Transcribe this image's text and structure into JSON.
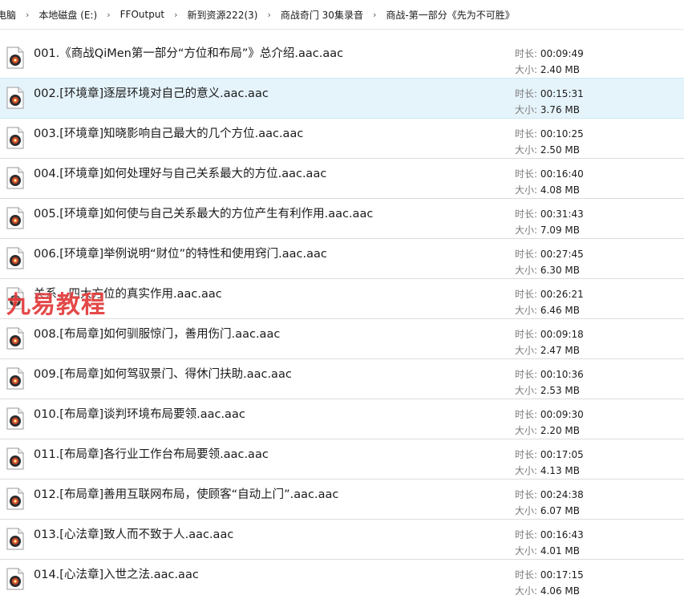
{
  "breadcrumb": [
    "电脑",
    "本地磁盘 (E:)",
    "FFOutput",
    "新到资源222(3)",
    "商战奇门 30集录音",
    "商战-第一部分《先为不可胜》"
  ],
  "labels": {
    "duration": "时长: ",
    "size": "大小: "
  },
  "watermark": "九易教程",
  "files": [
    {
      "name": "001.《商战QiMen第一部分“方位和布局”》总介绍.aac.aac",
      "duration": "00:09:49",
      "size": "2.40 MB"
    },
    {
      "name": "002.[环境章]逐层环境对自己的意义.aac.aac",
      "duration": "00:15:31",
      "size": "3.76 MB"
    },
    {
      "name": "003.[环境章]知晓影响自己最大的几个方位.aac.aac",
      "duration": "00:10:25",
      "size": "2.50 MB"
    },
    {
      "name": "004.[环境章]如何处理好与自己关系最大的方位.aac.aac",
      "duration": "00:16:40",
      "size": "4.08 MB"
    },
    {
      "name": "005.[环境章]如何使与自己关系最大的方位产生有利作用.aac.aac",
      "duration": "00:31:43",
      "size": "7.09 MB"
    },
    {
      "name": "006.[环境章]举例说明“财位”的特性和使用窍门.aac.aac",
      "duration": "00:27:45",
      "size": "6.30 MB"
    },
    {
      "name": "关系、四大方位的真实作用.aac.aac",
      "duration": "00:26:21",
      "size": "6.46 MB"
    },
    {
      "name": "008.[布局章]如何驯服惊门，善用伤门.aac.aac",
      "duration": "00:09:18",
      "size": "2.47 MB"
    },
    {
      "name": "009.[布局章]如何驾驭景门、得休门扶助.aac.aac",
      "duration": "00:10:36",
      "size": "2.53 MB"
    },
    {
      "name": "010.[布局章]谈判环境布局要领.aac.aac",
      "duration": "00:09:30",
      "size": "2.20 MB"
    },
    {
      "name": "011.[布局章]各行业工作台布局要领.aac.aac",
      "duration": "00:17:05",
      "size": "4.13 MB"
    },
    {
      "name": "012.[布局章]善用互联网布局，使顾客“自动上门”.aac.aac",
      "duration": "00:24:38",
      "size": "6.07 MB"
    },
    {
      "name": "013.[心法章]致人而不致于人.aac.aac",
      "duration": "00:16:43",
      "size": "4.01 MB"
    },
    {
      "name": "014.[心法章]入世之法.aac.aac",
      "duration": "00:17:15",
      "size": "4.06 MB"
    }
  ],
  "selected_index": 1,
  "colors": {
    "selected_bg": "#e5f3fb",
    "watermark": "#e23a3a"
  }
}
